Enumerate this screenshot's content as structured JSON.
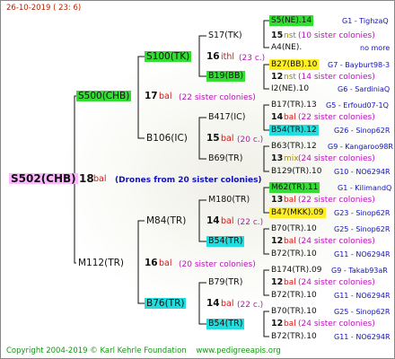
{
  "header": {
    "date": "26-10-2019 ( 23: 6)"
  },
  "footer": {
    "copyright": "Copyright 2004-2019 © Karl Kehrle Foundation",
    "site": "www.pedigreeapis.org"
  },
  "root": {
    "id": "S502(CHB)",
    "year": "18",
    "race": "bal",
    "note": "(Drones from 20 sister colonies)"
  },
  "gen1": [
    {
      "id": "S500(CHB)",
      "year": "17",
      "race": "bal",
      "note": "(22 sister colonies)"
    },
    {
      "id": "M112(TR)",
      "year": "16",
      "race": "bal",
      "note": "(20 sister colonies)"
    }
  ],
  "gen2": [
    {
      "id": "S100(TK)",
      "year": "16",
      "race": "ithl",
      "note": "(23 c.)"
    },
    {
      "id": "B106(IC)",
      "year": "15",
      "race": "bal",
      "note": "(20 c.)"
    },
    {
      "id": "M84(TR)",
      "year": "14",
      "race": "bal",
      "note": "(22 c.)"
    },
    {
      "id": "B76(TR)",
      "year": "14",
      "race": "bal",
      "note": "(22 c.)"
    }
  ],
  "gen3": [
    {
      "id": "S17(TK)",
      "year": "15",
      "race": "nst",
      "note": "(10 sister colonies)"
    },
    {
      "id": "B19(BB)",
      "year": "12",
      "race": "nst",
      "note": "(14 sister colonies)"
    },
    {
      "id": "B417(IC)",
      "year": "14",
      "race": "bal",
      "note": "(22 sister colonies)"
    },
    {
      "id": "B69(TR)",
      "year": "13",
      "race": "mix",
      "note": "(24 sister colonies)"
    },
    {
      "id": "M180(TR)",
      "year": "13",
      "race": "bal",
      "note": "(22 sister colonies)"
    },
    {
      "id": "B54(TR)",
      "year": "12",
      "race": "bal",
      "note": "(24 sister colonies)"
    },
    {
      "id": "B79(TR)",
      "year": "12",
      "race": "bal",
      "note": "(24 sister colonies)"
    },
    {
      "id": "B54(TR)",
      "year": "12",
      "race": "bal",
      "note": "(24 sister colonies)"
    }
  ],
  "gen4": [
    {
      "id": "S5(NE).14",
      "loc": "G1 - TighzaQ"
    },
    {
      "id": "A4(NE).",
      "loc": "no more"
    },
    {
      "id": "B27(BB).10",
      "loc": "G7 - Bayburt98-3"
    },
    {
      "id": "I2(NE).10",
      "loc": "G6 - SardiniaQ"
    },
    {
      "id": "B17(TR).13",
      "loc": "G5 - Erfoud07-1Q"
    },
    {
      "id": "B54(TR).12",
      "loc": "G26 - Sinop62R"
    },
    {
      "id": "B63(TR).12",
      "loc": "G9 - Kangaroo98R"
    },
    {
      "id": "B129(TR).10",
      "loc": "G10 - NO6294R"
    },
    {
      "id": "M62(TR).11",
      "loc": "G1 - KilimandQ"
    },
    {
      "id": "B47(MKK).09",
      "loc": "G23 - Sinop62R"
    },
    {
      "id": "B70(TR).10",
      "loc": "G25 - Sinop62R"
    },
    {
      "id": "B72(TR).10",
      "loc": "G11 - NO6294R"
    },
    {
      "id": "B174(TR).09",
      "loc": "G9 - Takab93aR"
    },
    {
      "id": "B72(TR).10",
      "loc": "G11 - NO6294R"
    },
    {
      "id": "B70(TR).10",
      "loc": "G25 - Sinop62R"
    },
    {
      "id": "B72(TR).10",
      "loc": "G11 - NO6294R"
    }
  ]
}
